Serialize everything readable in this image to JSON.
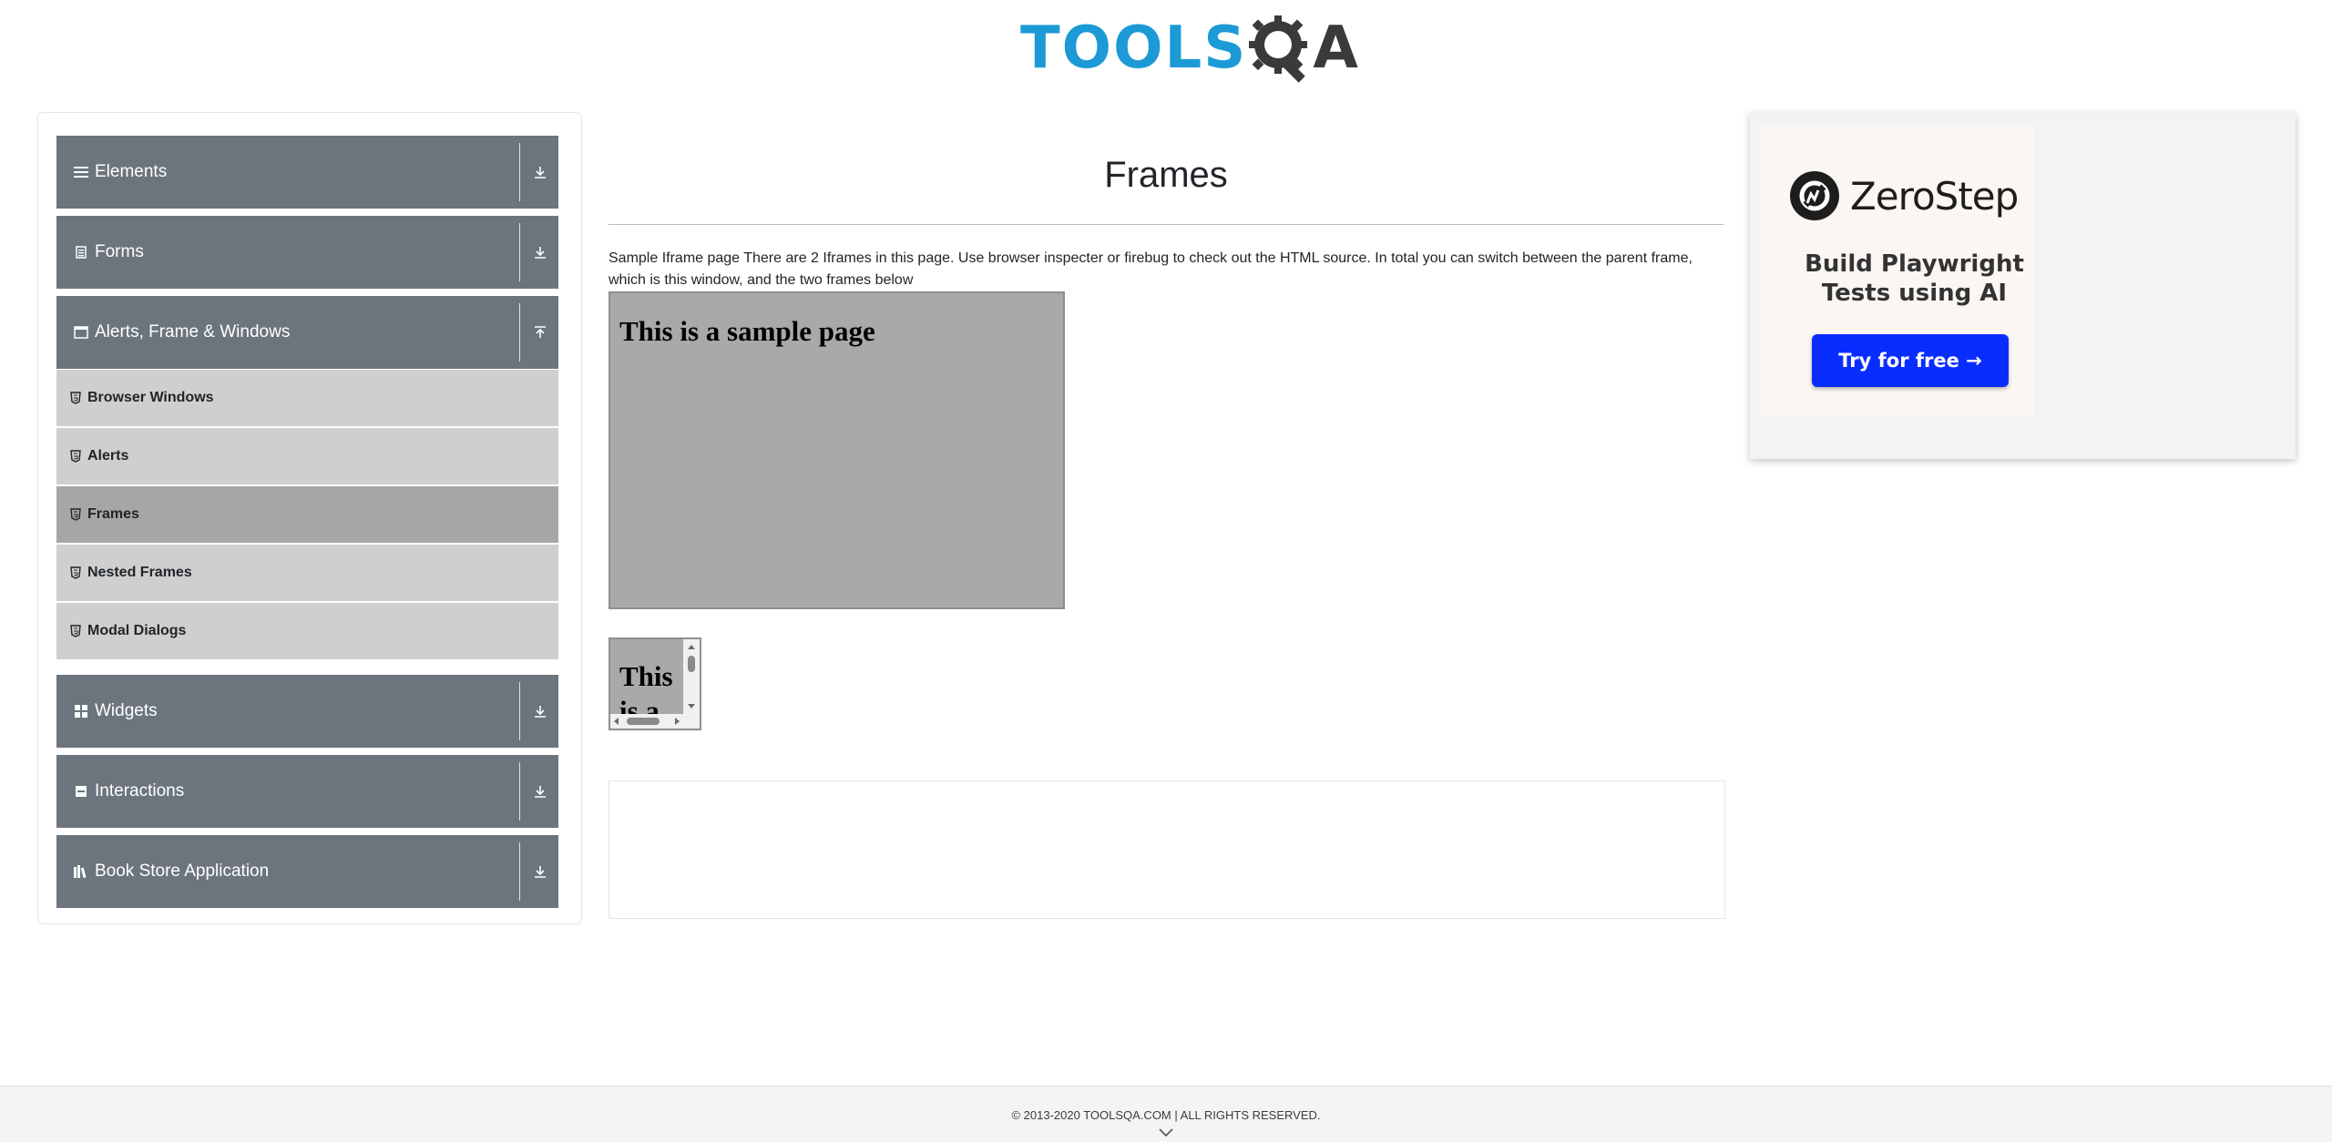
{
  "logo": {
    "part1": "TOOLS",
    "part2": "A"
  },
  "sidebar": {
    "groups": [
      {
        "label": "Elements",
        "icon": "menu-icon",
        "state": "collapsed"
      },
      {
        "label": "Forms",
        "icon": "form-icon",
        "state": "collapsed"
      },
      {
        "label": "Alerts, Frame & Windows",
        "icon": "window-icon",
        "state": "expanded"
      },
      {
        "label": "Widgets",
        "icon": "grid-icon",
        "state": "collapsed"
      },
      {
        "label": "Interactions",
        "icon": "interaction-icon",
        "state": "collapsed"
      },
      {
        "label": "Book Store Application",
        "icon": "books-icon",
        "state": "collapsed"
      }
    ],
    "alerts_items": [
      {
        "label": "Browser Windows",
        "active": false
      },
      {
        "label": "Alerts",
        "active": false
      },
      {
        "label": "Frames",
        "active": true
      },
      {
        "label": "Nested Frames",
        "active": false
      },
      {
        "label": "Modal Dialogs",
        "active": false
      }
    ]
  },
  "main": {
    "title": "Frames",
    "description": "Sample Iframe page There are 2 Iframes in this page. Use browser inspecter or firebug to check out the HTML source. In total you can switch between the parent frame, which is this window, and the two frames below",
    "frame1_heading": "This is a sample page",
    "frame2_heading": "This is a sample page"
  },
  "ad": {
    "brand": "ZeroStep",
    "headline_line1": "Build Playwright",
    "headline_line2": "Tests using AI",
    "cta": "Try for free →",
    "cta_color": "#0a2dff"
  },
  "footer": {
    "text": "© 2013-2020 TOOLSQA.COM | ALL RIGHTS RESERVED."
  },
  "colors": {
    "sidebar_header": "#6c757d",
    "sub_item": "#cfcfcf",
    "sub_item_active": "#a6a6a6",
    "logo_blue": "#1c9ad6"
  }
}
